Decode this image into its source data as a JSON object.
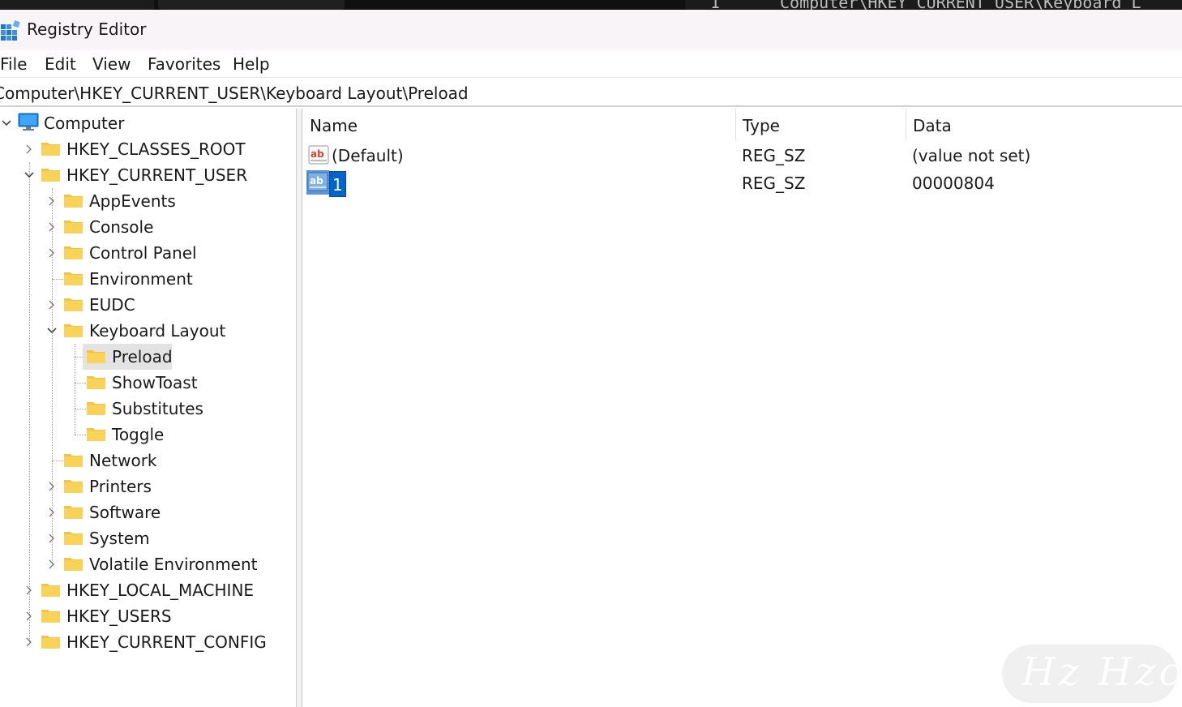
{
  "background_terminal": {
    "number": "1",
    "path": "Computer\\HKEY_CURRENT_USER\\Keyboard L"
  },
  "window": {
    "title": "Registry Editor",
    "icon": "registry-editor-icon"
  },
  "menu": {
    "file": "File",
    "edit": "Edit",
    "view": "View",
    "favorites": "Favorites",
    "help": "Help"
  },
  "address": "Computer\\HKEY_CURRENT_USER\\Keyboard Layout\\Preload",
  "tree": {
    "root": "Computer",
    "hkcr": "HKEY_CLASSES_ROOT",
    "hkcu": "HKEY_CURRENT_USER",
    "app_events": "AppEvents",
    "console": "Console",
    "control_panel": "Control Panel",
    "environment": "Environment",
    "eudc": "EUDC",
    "keyboard_layout": "Keyboard Layout",
    "preload": "Preload",
    "show_toast": "ShowToast",
    "substitutes": "Substitutes",
    "toggle": "Toggle",
    "network": "Network",
    "printers": "Printers",
    "software": "Software",
    "system": "System",
    "volatile_environment": "Volatile Environment",
    "hklm": "HKEY_LOCAL_MACHINE",
    "hku": "HKEY_USERS",
    "hkcc": "HKEY_CURRENT_CONFIG"
  },
  "list": {
    "columns": {
      "name": "Name",
      "type": "Type",
      "data": "Data"
    },
    "rows": [
      {
        "name": "(Default)",
        "type": "REG_SZ",
        "data": "(value not set)"
      },
      {
        "name": "1",
        "type": "REG_SZ",
        "data": "00000804"
      }
    ]
  },
  "watermark": "Hz Hzc",
  "colors": {
    "selection": "#0064c8",
    "folder": "#f7c948",
    "tree_selected": "#e3e3e3"
  }
}
